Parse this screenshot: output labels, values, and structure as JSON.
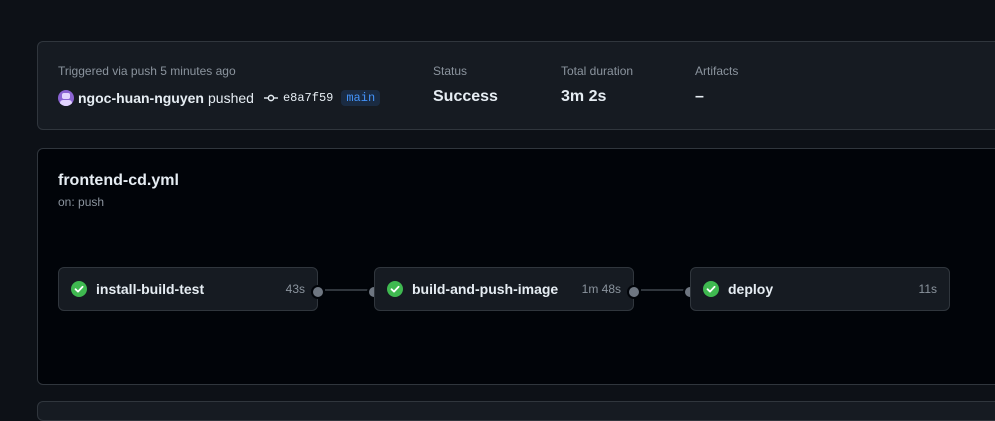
{
  "summary": {
    "trigger_text": "Triggered via push 5 minutes ago",
    "actor": "ngoc-huan-nguyen",
    "action": "pushed",
    "commit_sha": "e8a7f59",
    "branch": "main",
    "status_label": "Status",
    "status_value": "Success",
    "duration_label": "Total duration",
    "duration_value": "3m 2s",
    "artifacts_label": "Artifacts",
    "artifacts_value": "–"
  },
  "workflow": {
    "file": "frontend-cd.yml",
    "trigger": "on: push",
    "jobs": [
      {
        "name": "install-build-test",
        "duration": "43s",
        "status": "success"
      },
      {
        "name": "build-and-push-image",
        "duration": "1m 48s",
        "status": "success"
      },
      {
        "name": "deploy",
        "duration": "11s",
        "status": "success"
      }
    ]
  },
  "colors": {
    "success": "#3fb950",
    "accent": "#4493f8",
    "background": "#0d1117"
  }
}
